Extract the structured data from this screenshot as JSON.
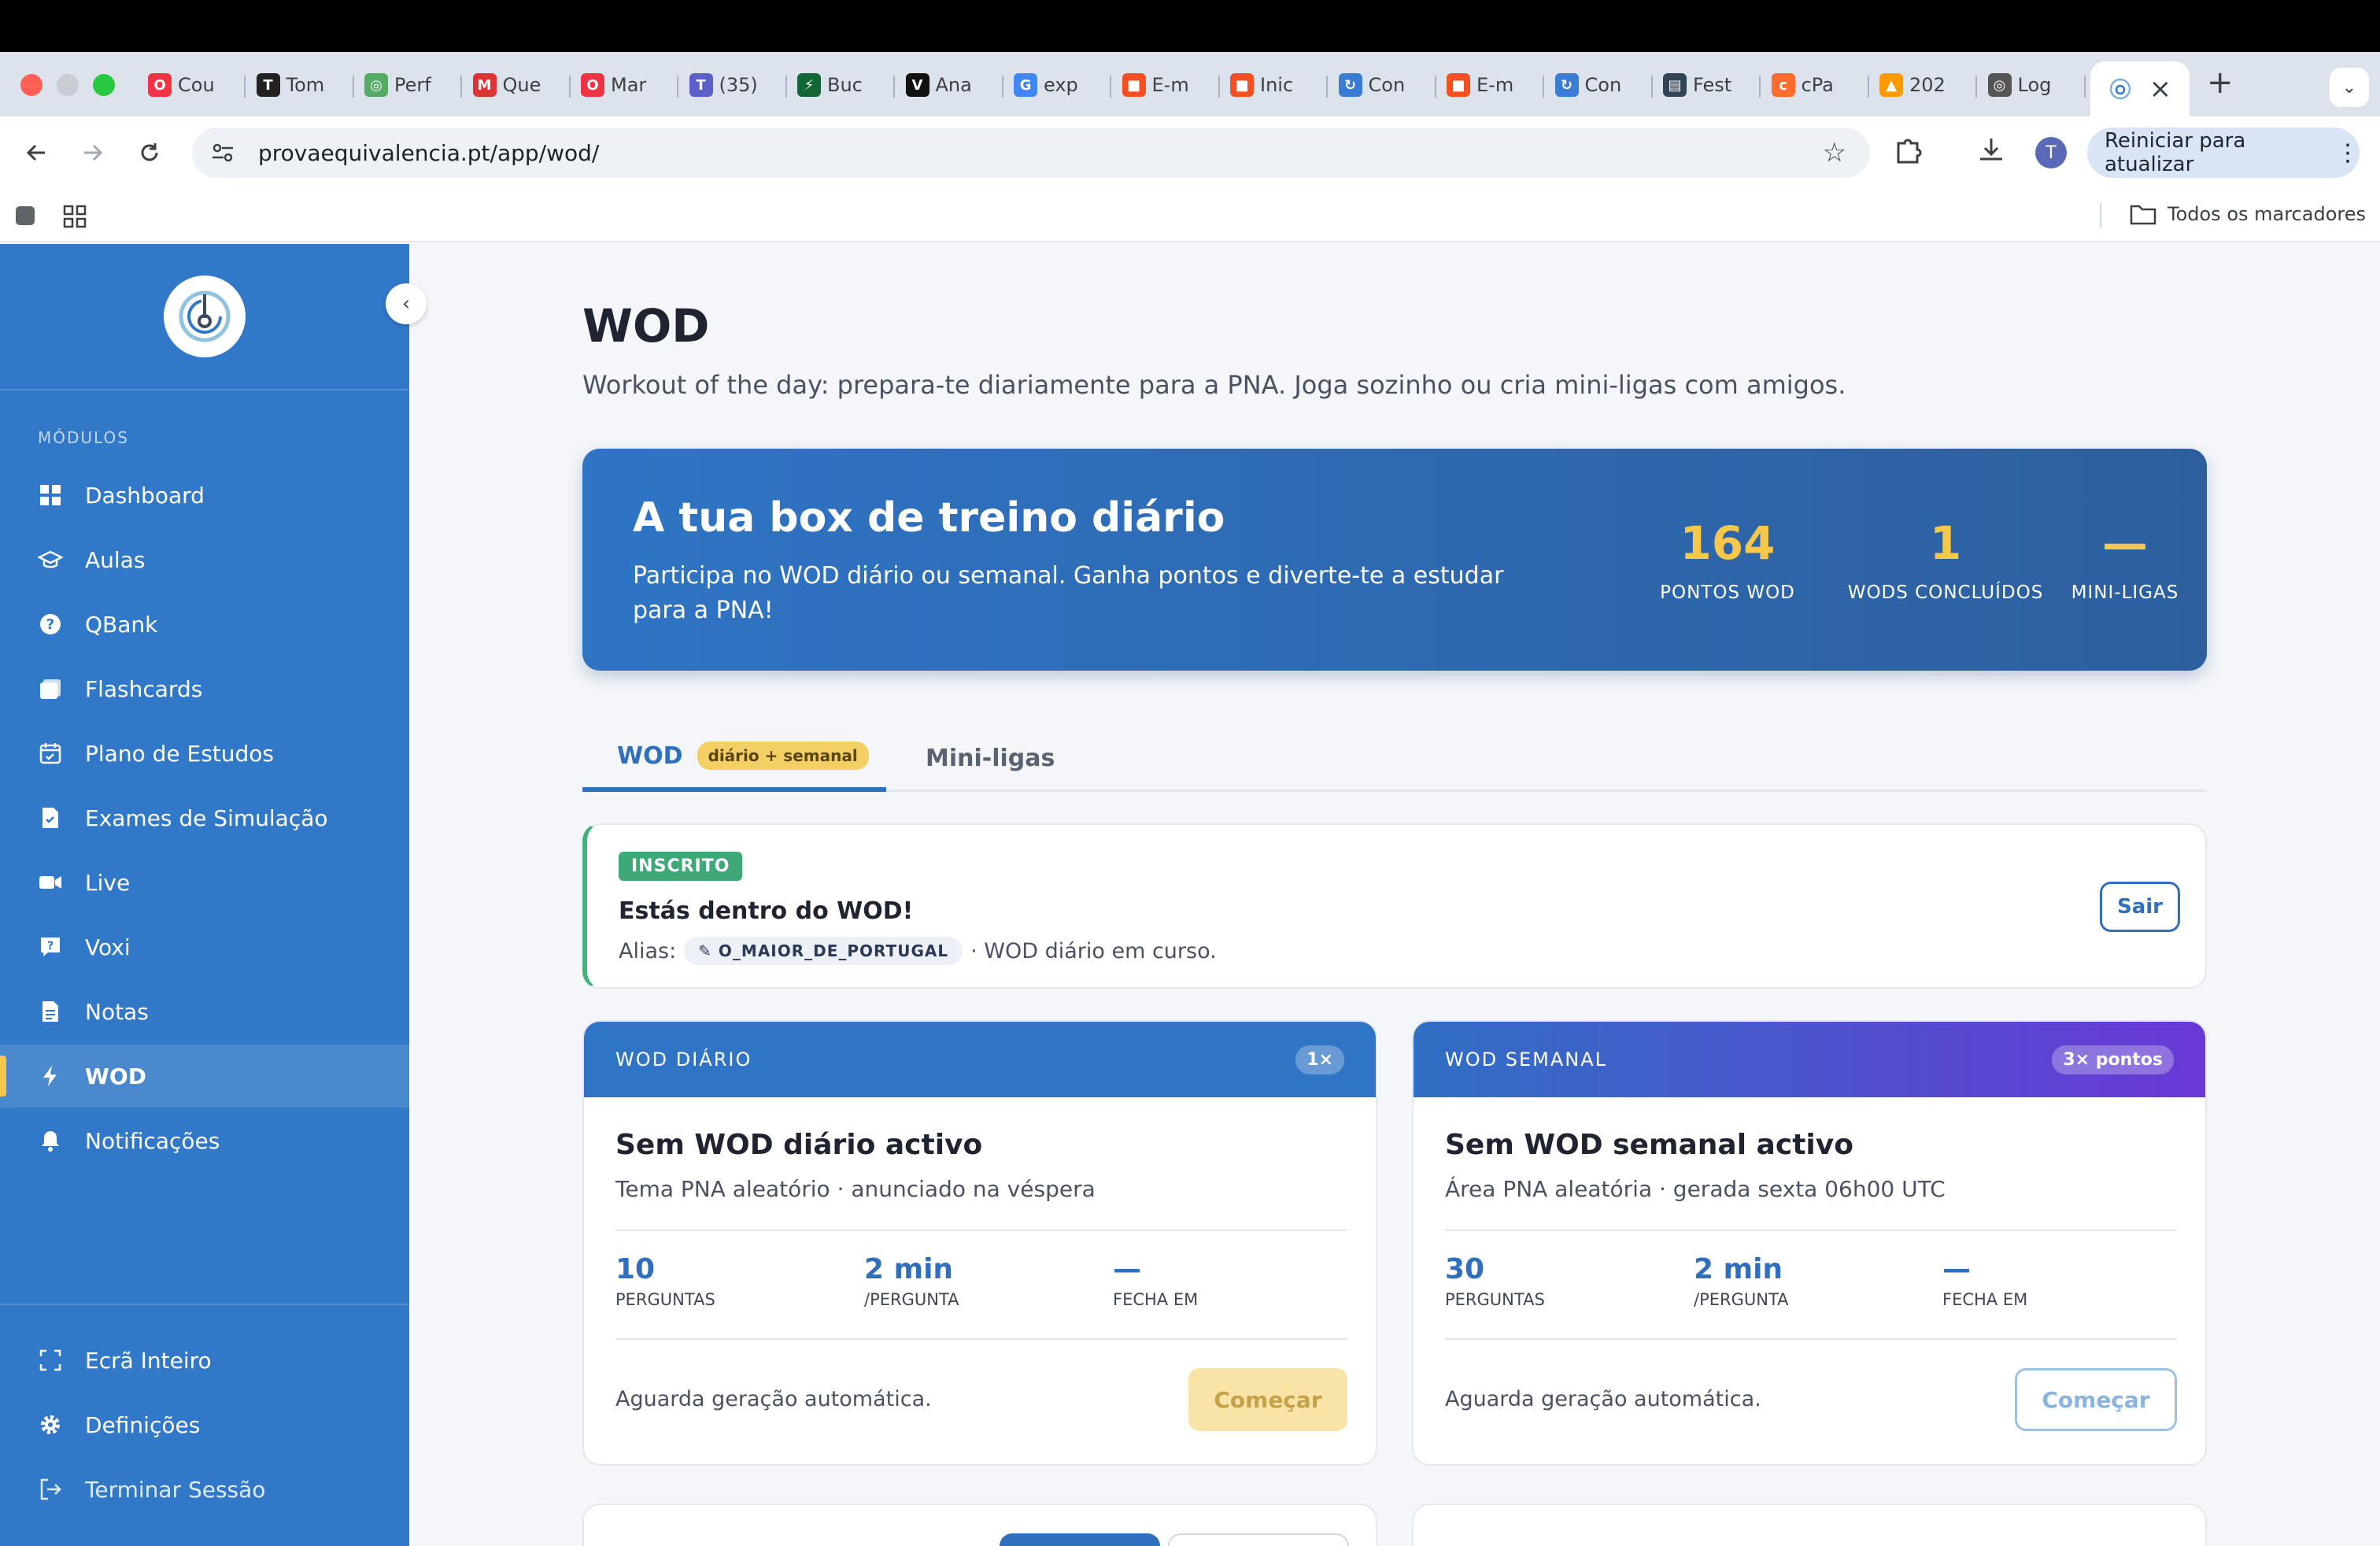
{
  "browser": {
    "tabs": [
      {
        "label": "Cou",
        "icon": "opera-icon",
        "color": "#e34"
      },
      {
        "label": "Tom",
        "icon": "tomatoes-icon",
        "color": "#222"
      },
      {
        "label": "Perf",
        "icon": "globe-icon",
        "color": "#5a6"
      },
      {
        "label": "Que",
        "icon": "gmail-icon",
        "color": "#d33"
      },
      {
        "label": "Mar",
        "icon": "opera-icon",
        "color": "#e34"
      },
      {
        "label": "(35)",
        "icon": "teams-icon",
        "color": "#5b5fc7"
      },
      {
        "label": "Buc",
        "icon": "bolt-icon",
        "color": "#163"
      },
      {
        "label": "Ana",
        "icon": "v-icon",
        "color": "#111"
      },
      {
        "label": "exp",
        "icon": "google-icon",
        "color": "#4285f4"
      },
      {
        "label": "E-m",
        "icon": "microsoft-icon",
        "color": "#f25022"
      },
      {
        "label": "Inic",
        "icon": "microsoft-icon",
        "color": "#f25022"
      },
      {
        "label": "Con",
        "icon": "sync-icon",
        "color": "#3a7bd5"
      },
      {
        "label": "E-m",
        "icon": "microsoft-icon",
        "color": "#f25022"
      },
      {
        "label": "Con",
        "icon": "sync-icon",
        "color": "#3a7bd5"
      },
      {
        "label": "Fest",
        "icon": "doc-icon",
        "color": "#345"
      },
      {
        "label": "cPa",
        "icon": "cpanel-icon",
        "color": "#ff6c2c"
      },
      {
        "label": "202",
        "icon": "pma-icon",
        "color": "#f90"
      },
      {
        "label": "Log",
        "icon": "globe-icon",
        "color": "#555"
      }
    ],
    "new_tab": "+",
    "close_tab": "×",
    "url": "provaequivalencia.pt/app/wod/",
    "restart_label": "Reiniciar para atualizar",
    "profile_initial": "T",
    "bookmarks_all": "Todos os marcadores"
  },
  "sidebar": {
    "section_label": "MÓDULOS",
    "items": [
      {
        "label": "Dashboard",
        "icon": "grid-icon"
      },
      {
        "label": "Aulas",
        "icon": "graduation-cap-icon"
      },
      {
        "label": "QBank",
        "icon": "question-icon"
      },
      {
        "label": "Flashcards",
        "icon": "cards-icon"
      },
      {
        "label": "Plano de Estudos",
        "icon": "calendar-icon"
      },
      {
        "label": "Exames de Simulação",
        "icon": "exam-icon"
      },
      {
        "label": "Live",
        "icon": "video-icon"
      },
      {
        "label": "Voxi",
        "icon": "chat-question-icon"
      },
      {
        "label": "Notas",
        "icon": "note-icon"
      },
      {
        "label": "WOD",
        "icon": "bolt-icon",
        "active": true
      },
      {
        "label": "Notificações",
        "icon": "bell-icon"
      }
    ],
    "bottom_items": [
      {
        "label": "Ecrã Inteiro",
        "icon": "fullscreen-icon"
      },
      {
        "label": "Definições",
        "icon": "gear-icon"
      },
      {
        "label": "Terminar Sessão",
        "icon": "logout-icon"
      }
    ],
    "accent": "#3278c8"
  },
  "main": {
    "title": "WOD",
    "subtitle": "Workout of the day: prepara-te diariamente para a PNA. Joga sozinho ou cria mini-ligas com amigos.",
    "hero": {
      "title": "A tua box de treino diário",
      "description": "Participa no WOD diário ou semanal. Ganha pontos e diverte-te a estudar para a PNA!",
      "stats": [
        {
          "value": "164",
          "label": "PONTOS WOD"
        },
        {
          "value": "1",
          "label": "WODS CONCLUÍDOS"
        },
        {
          "value": "—",
          "label": "MINI-LIGAS"
        }
      ]
    },
    "tabs": [
      {
        "label": "WOD",
        "pill": "diário + semanal"
      },
      {
        "label": "Mini-ligas"
      }
    ],
    "enrolled": {
      "badge": "INSCRITO",
      "title": "Estás dentro do WOD!",
      "alias_label": "Alias:",
      "alias_value": "✎ O_MAIOR_DE_PORTUGAL",
      "status": "· WOD diário em curso.",
      "exit_label": "Sair"
    },
    "daily": {
      "header": "WOD DIÁRIO",
      "multiplier": "1×",
      "title": "Sem WOD diário activo",
      "subtitle": "Tema PNA aleatório · anunciado na véspera",
      "stats": [
        {
          "value": "10",
          "label": "PERGUNTAS"
        },
        {
          "value": "2 min",
          "label": "/PERGUNTA"
        },
        {
          "value": "—",
          "label": "FECHA EM"
        }
      ],
      "footer": "Aguarda geração automática.",
      "button": "Começar"
    },
    "weekly": {
      "header": "WOD SEMANAL",
      "multiplier": "3× pontos",
      "title": "Sem WOD semanal activo",
      "subtitle": "Área PNA aleatória · gerada sexta 06h00 UTC",
      "stats": [
        {
          "value": "30",
          "label": "PERGUNTAS"
        },
        {
          "value": "2 min",
          "label": "/PERGUNTA"
        },
        {
          "value": "—",
          "label": "FECHA EM"
        }
      ],
      "footer": "Aguarda geração automática.",
      "button": "Começar"
    }
  }
}
